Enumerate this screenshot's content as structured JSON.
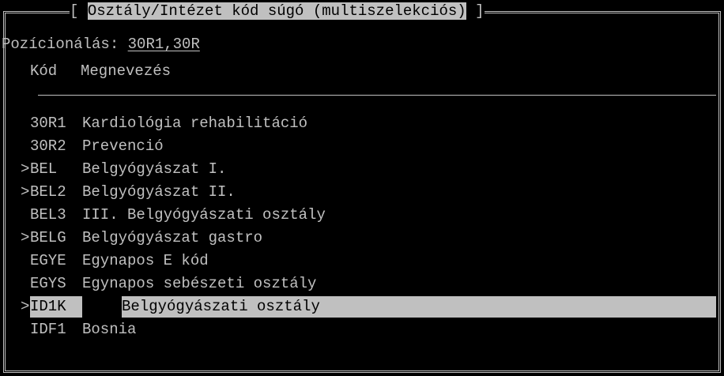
{
  "window": {
    "title_prefix": "[ ",
    "title": "Osztály/Intézet kód súgó (multiszelekciós)",
    "title_suffix": " ]"
  },
  "positioning": {
    "label": "Pozícionálás:",
    "value": "30R1,30R"
  },
  "columns": {
    "code": "Kód",
    "name": "Megnevezés"
  },
  "rows": [
    {
      "marker": "",
      "code": "30R1",
      "name": "Kardiológia rehabilitáció",
      "selected": false
    },
    {
      "marker": "",
      "code": "30R2",
      "name": "Prevenció",
      "selected": false
    },
    {
      "marker": ">",
      "code": "BEL",
      "name": "Belgyógyászat I.",
      "selected": false
    },
    {
      "marker": ">",
      "code": "BEL2",
      "name": "Belgyógyászat II.",
      "selected": false
    },
    {
      "marker": "",
      "code": "BEL3",
      "name": "III. Belgyógyászati osztály",
      "selected": false
    },
    {
      "marker": ">",
      "code": "BELG",
      "name": "Belgyógyászat gastro",
      "selected": false
    },
    {
      "marker": "",
      "code": "EGYE",
      "name": "Egynapos E kód",
      "selected": false
    },
    {
      "marker": "",
      "code": "EGYS",
      "name": "Egynapos sebészeti osztály",
      "selected": false
    },
    {
      "marker": ">",
      "code": "ID1K",
      "name": "Belgyógyászati osztály",
      "selected": true
    },
    {
      "marker": "",
      "code": "IDF1",
      "name": "Bosnia",
      "selected": false
    }
  ],
  "colors": {
    "background": "#000000",
    "foreground": "#c0c0c0",
    "highlight": "#c0c0c0",
    "highlight_text": "#000000"
  }
}
